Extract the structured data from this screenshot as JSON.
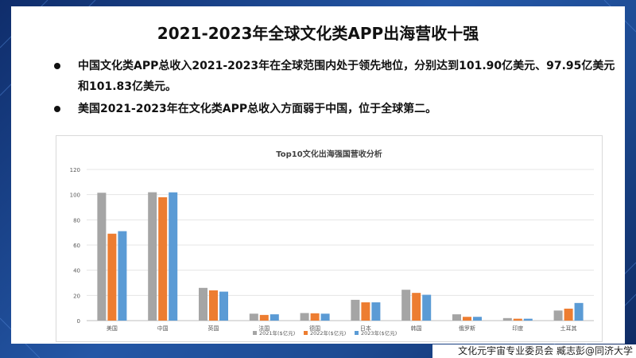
{
  "title": "2021-2023年全球文化类APP出海营收十强",
  "bullets": [
    "中国文化类APP总收入2021-2023年在全球范围内处于领先地位，分别达到101.90亿美元、97.95亿美元和101.83亿美元。",
    "美国2021-2023年在文化类APP总收入方面弱于中国，位于全球第二。"
  ],
  "footer": "文化元宇宙专业委员会    臧志彭@同济大学",
  "colors": {
    "series": [
      "#a5a5a5",
      "#ed7d31",
      "#5b9bd5"
    ],
    "background": "#1c3f7a"
  },
  "chart_data": {
    "type": "bar",
    "title": "Top10文化出海强国营收分析",
    "categories": [
      "美国",
      "中国",
      "英国",
      "法国",
      "德国",
      "日本",
      "韩国",
      "俄罗斯",
      "印度",
      "土耳其"
    ],
    "series": [
      {
        "name": "2021年($亿元)",
        "values": [
          101.5,
          101.9,
          26,
          5.5,
          6,
          16.5,
          24.5,
          5,
          2,
          8
        ]
      },
      {
        "name": "2022年($亿元)",
        "values": [
          69,
          97.95,
          24,
          4.5,
          5.8,
          14.5,
          22,
          3,
          1.5,
          9.5
        ]
      },
      {
        "name": "2023年($亿元)",
        "values": [
          71,
          101.83,
          23,
          5,
          5.5,
          14.5,
          20.5,
          3,
          1.5,
          14
        ]
      }
    ],
    "yticks": [
      "0",
      "20",
      "40",
      "60",
      "80",
      "100",
      "120"
    ],
    "ylim": [
      0,
      120
    ],
    "grid": true,
    "legend": "bottom"
  }
}
